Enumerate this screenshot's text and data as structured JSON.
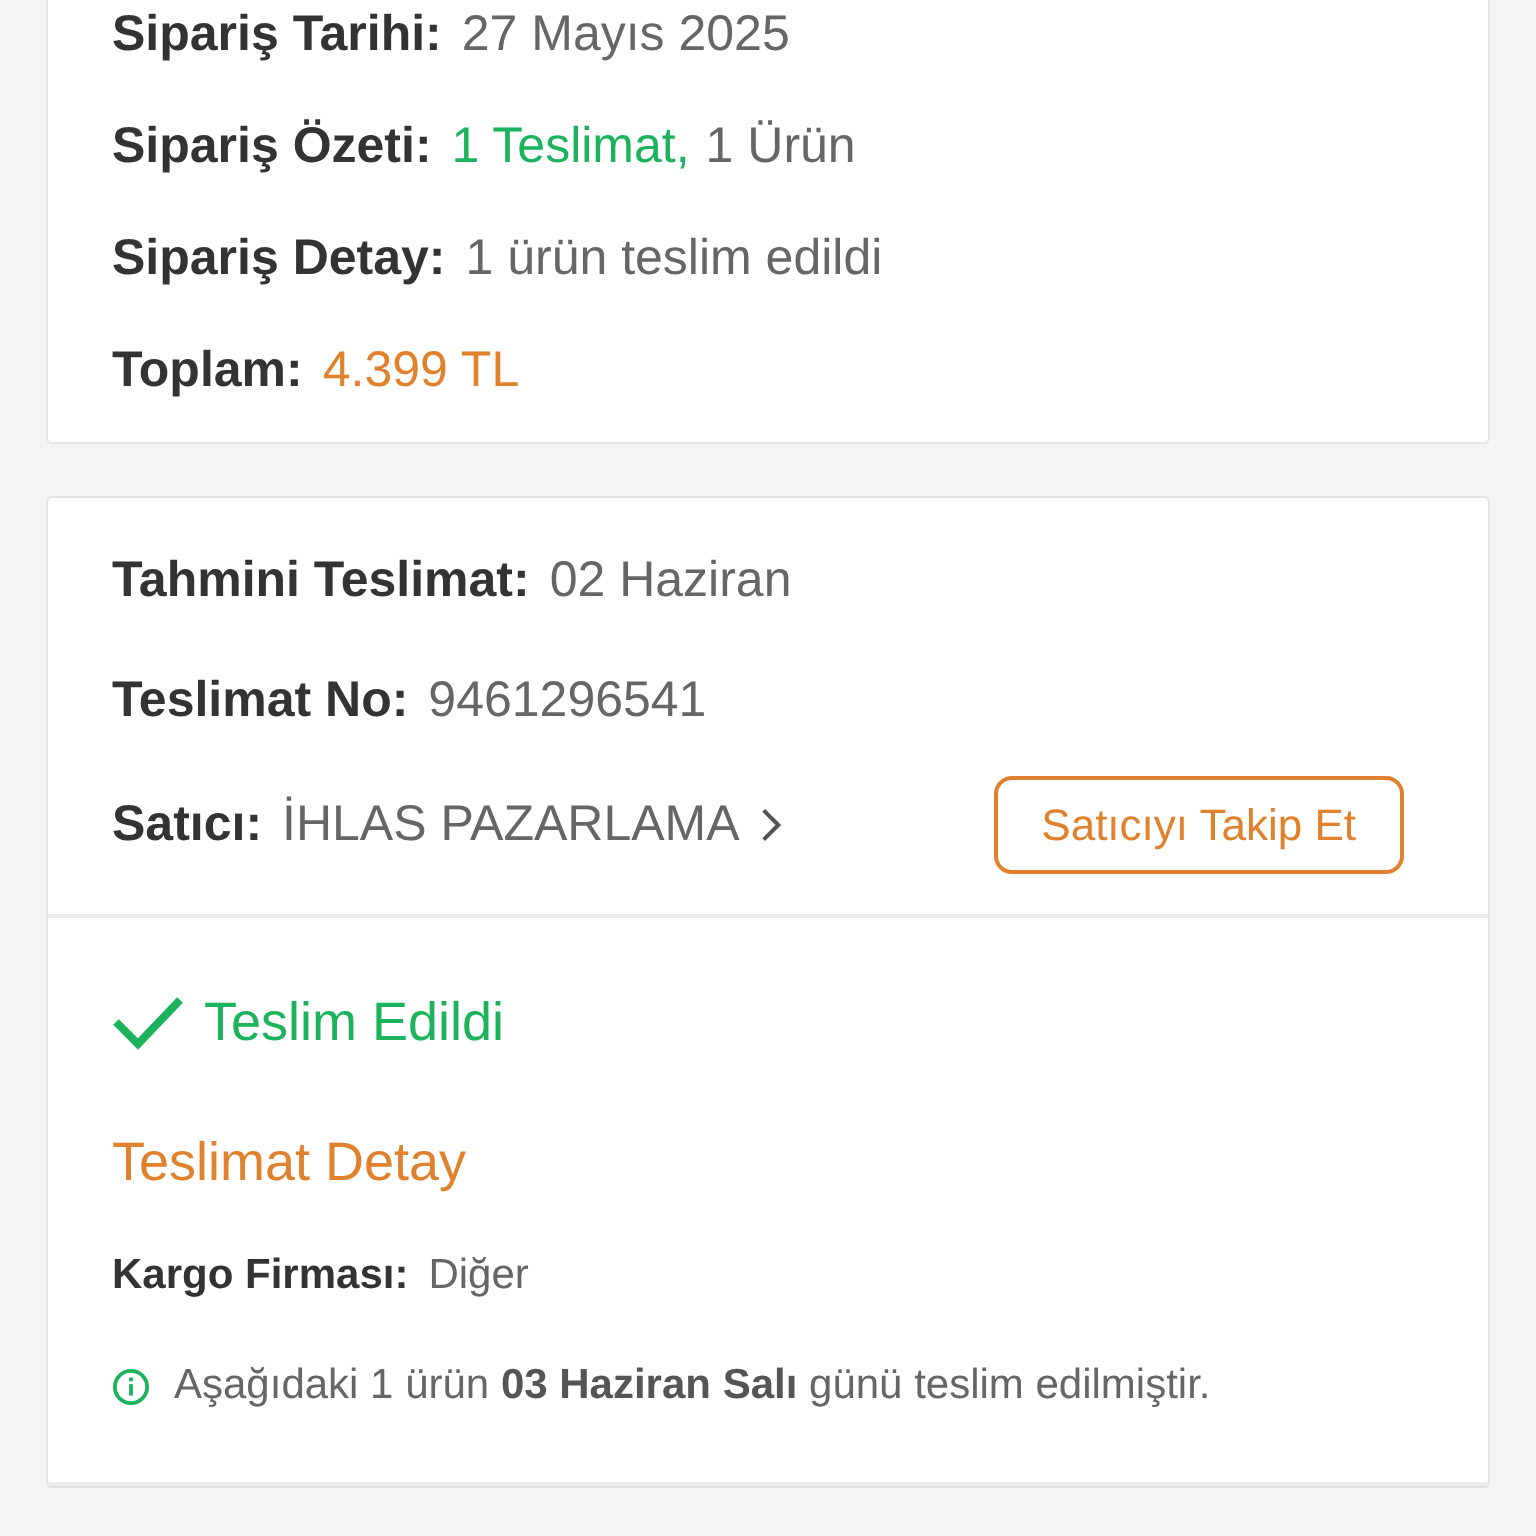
{
  "order_card": {
    "rows": [
      {
        "label": "Sipariş Tarihi:",
        "values": [
          {
            "text": "27 Mayıs 2025",
            "color": "#666666"
          }
        ]
      },
      {
        "label": "Sipariş Özeti:",
        "values": [
          {
            "text": "1 Teslimat,",
            "color": "#1db35d"
          },
          {
            "text": "1 Ürün",
            "color": "#666666"
          }
        ]
      },
      {
        "label": "Sipariş Detay:",
        "values": [
          {
            "text": "1 ürün teslim edildi",
            "color": "#666666"
          }
        ]
      },
      {
        "label": "Toplam:",
        "values": [
          {
            "text": "4.399 TL",
            "color": "#e0822d"
          }
        ]
      }
    ]
  },
  "delivery_card": {
    "rows": [
      {
        "label": "Tahmini Teslimat:",
        "value": "02 Haziran"
      },
      {
        "label": "Teslimat No:",
        "value": "9461296541"
      }
    ],
    "seller": {
      "label": "Satıcı:",
      "name": "İHLAS PAZARLAMA",
      "follow_button": "Satıcıyı Takip Et"
    },
    "status": {
      "text": "Teslim Edildi",
      "delivered": true
    },
    "detail_title": "Teslimat Detay",
    "cargo": {
      "label": "Kargo Firması:",
      "value": "Diğer"
    },
    "info": "Aşağıdaki 1 ürün **03 Haziran Salı** günü teslim edilmiştir."
  }
}
